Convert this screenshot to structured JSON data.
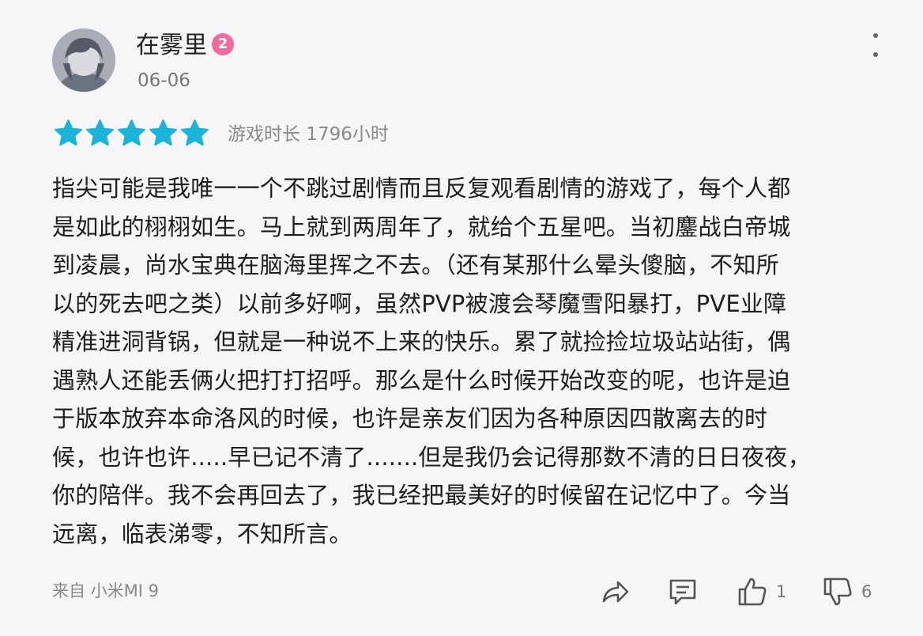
{
  "review": {
    "username": "在雾里",
    "level": "2",
    "date": "06-06",
    "rating": 5,
    "playtime": "游戏时长 1796小时",
    "content": [
      "指尖可能是我唯一一个不跳过剧情而且反复观看剧情的游戏了，每个人都",
      "是如此的栩栩如生。马上就到两周年了，就给个五星吧。当初鏖战白帝城",
      "到凌晨，尚水宝典在脑海里挥之不去。（还有某那什么晕头傻脑，不知所",
      "以的死去吧之类）以前多好啊，虽然PVP被渡会琴魔雪阳暴打，PVE业障",
      "精准进洞背锅，但就是一种说不上来的快乐。累了就捡捡垃圾站站街，偶",
      "遇熟人还能丢俩火把打打招呼。那么是什么时候开始改变的呢，也许是迫",
      "于版本放弃本命洛风的时候，也许是亲友们因为各种原因四散离去的时",
      "候，也许也许.....早已记不清了.......但是我仍会记得那数不清的日日夜夜，",
      "你的陪伴。我不会再回去了，我已经把最美好的时候留在记忆中了。今当",
      "远离，临表涕零，不知所言。"
    ],
    "device": "来自 小米MI 9",
    "like_count": "1",
    "dislike_count": "6"
  },
  "colors": {
    "star": "#1bb4d8",
    "badge": "#f06a9c",
    "text": "#1e1e1e",
    "muted": "#888888"
  },
  "icons": {
    "more": "more-vertical-icon",
    "star": "star-icon",
    "share": "share-icon",
    "comment": "comment-icon",
    "like": "thumbs-up-icon",
    "dislike": "thumbs-down-icon"
  }
}
